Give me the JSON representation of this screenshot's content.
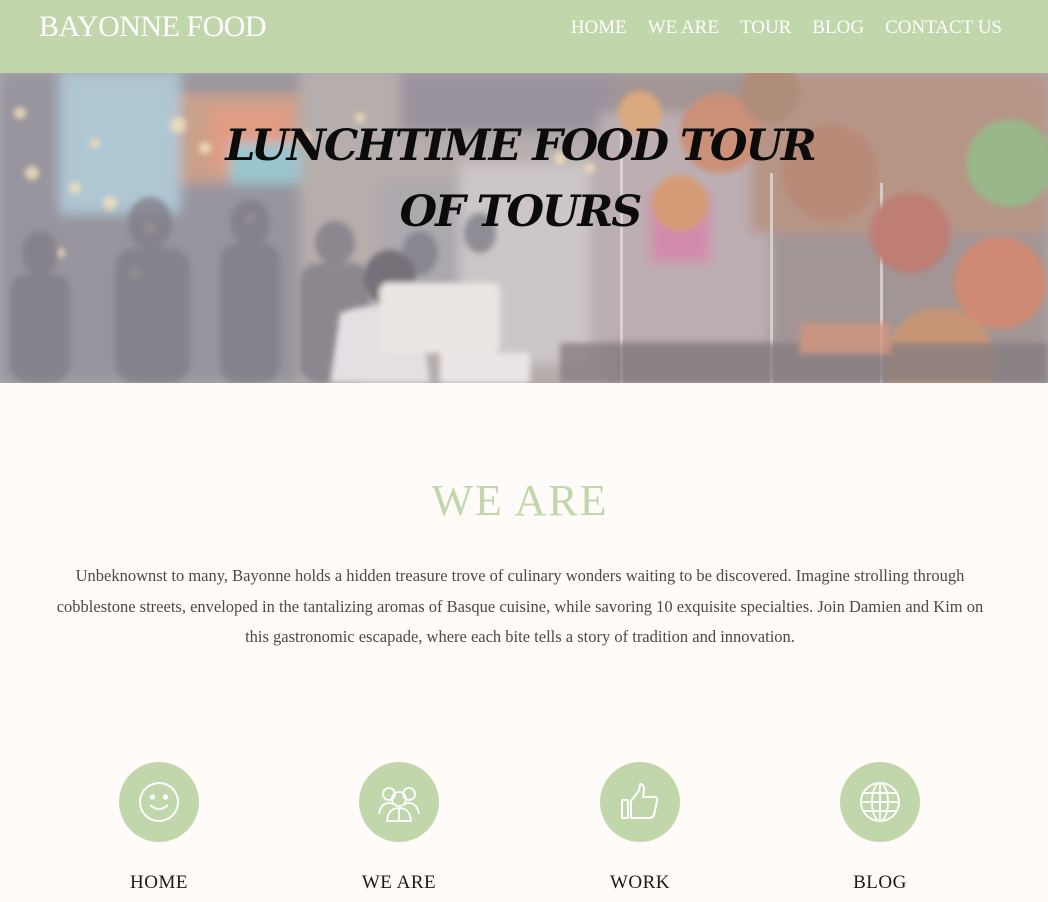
{
  "header": {
    "brand": "BAYONNE FOOD",
    "nav": [
      "HOME",
      "WE ARE",
      "TOUR",
      "BLOG",
      "CONTACT US"
    ]
  },
  "hero": {
    "title_line1": "LUNCHTIME FOOD TOUR",
    "title_line2": "OF TOURS"
  },
  "about": {
    "heading": "WE ARE",
    "text": "Unbeknownst to many, Bayonne holds a hidden treasure trove of culinary wonders waiting to be discovered. Imagine strolling through cobblestone streets, enveloped in the tantalizing aromas of Basque cuisine, while savoring 10 exquisite specialties. Join Damien and Kim on this gastronomic escapade, where each bite tells a story of tradition and innovation."
  },
  "features": [
    {
      "icon": "smile-icon",
      "label": "HOME"
    },
    {
      "icon": "people-icon",
      "label": "WE ARE"
    },
    {
      "icon": "thumbs-up-icon",
      "label": "WORK"
    },
    {
      "icon": "globe-icon",
      "label": "BLOG"
    }
  ],
  "colors": {
    "accent": "#c1d6ab",
    "background": "#fffbf8",
    "text": "#4a4a4a"
  }
}
